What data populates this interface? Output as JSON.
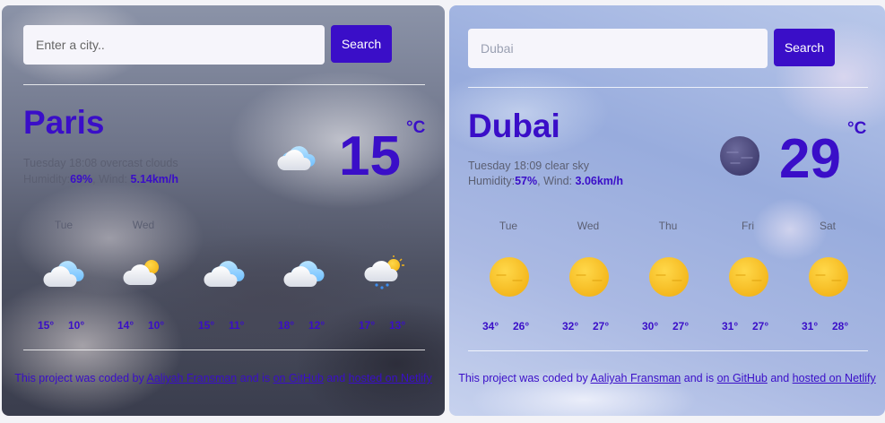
{
  "cards": [
    {
      "search": {
        "placeholder": "Enter a city..",
        "value": "",
        "button_label": "Search"
      },
      "city": "Paris",
      "datetime": "Tuesday 18:08",
      "condition": "overcast clouds",
      "humidity_label": "Humidity:",
      "humidity": "69%",
      "wind_label": "Wind:",
      "wind": "5.14km/h",
      "temperature": "15",
      "unit": "°C",
      "main_icon": "overcast-cloud-icon",
      "forecast": [
        {
          "day": "Tue",
          "high": "15°",
          "low": "10°",
          "icon": "cloud-icon"
        },
        {
          "day": "Wed",
          "high": "14°",
          "low": "10°",
          "icon": "sun-cloud-icon"
        },
        {
          "day": "Thu",
          "high": "15°",
          "low": "11°",
          "icon": "cloud-icon"
        },
        {
          "day": "Fri",
          "high": "18°",
          "low": "12°",
          "icon": "cloud-icon"
        },
        {
          "day": "Sat",
          "high": "17°",
          "low": "13°",
          "icon": "sun-rain-cloud-icon"
        }
      ],
      "footer": {
        "prefix": "This project was coded by ",
        "author": "Aaliyah Fransman",
        "middle": " and is ",
        "github": "on GitHub",
        "and": " and ",
        "netlify": "hosted on Netlify"
      }
    },
    {
      "search": {
        "placeholder": "Dubai",
        "value": "",
        "button_label": "Search"
      },
      "city": "Dubai",
      "datetime": "Tuesday 18:09",
      "condition": "clear sky",
      "humidity_label": "Humidity:",
      "humidity": "57%",
      "wind_label": "Wind:",
      "wind": "3.06km/h",
      "temperature": "29",
      "unit": "°C",
      "main_icon": "clear-night-moon-icon",
      "forecast": [
        {
          "day": "Tue",
          "high": "34°",
          "low": "26°",
          "icon": "sun-icon"
        },
        {
          "day": "Wed",
          "high": "32°",
          "low": "27°",
          "icon": "sun-icon"
        },
        {
          "day": "Thu",
          "high": "30°",
          "low": "27°",
          "icon": "sun-icon"
        },
        {
          "day": "Fri",
          "high": "31°",
          "low": "27°",
          "icon": "sun-icon"
        },
        {
          "day": "Sat",
          "high": "31°",
          "low": "28°",
          "icon": "sun-icon"
        }
      ],
      "footer": {
        "prefix": "This project was coded by ",
        "author": "Aaliyah Fransman",
        "middle": " and is ",
        "github": "on GitHub",
        "and": " and ",
        "netlify": "hosted on Netlify"
      }
    }
  ],
  "colors": {
    "accent": "#3a0ec8",
    "muted": "#5b5f72",
    "input_bg": "#f6f5fb"
  }
}
